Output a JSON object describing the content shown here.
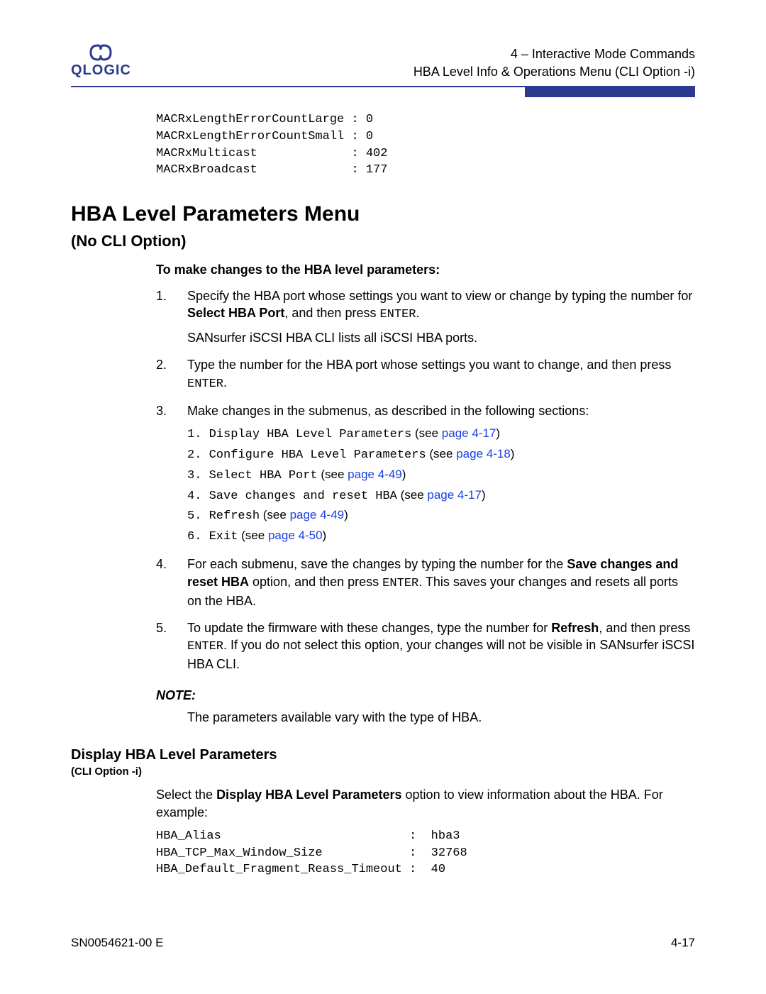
{
  "header": {
    "logo_text": "QLOGIC",
    "line1": "4 – Interactive Mode Commands",
    "line2": "HBA Level Info & Operations Menu (CLI Option -i)"
  },
  "mac_block": "MACRxLengthErrorCountLarge : 0\nMACRxLengthErrorCountSmall : 0\nMACRxMulticast             : 402\nMACRxBroadcast             : 177",
  "section": {
    "title": "HBA Level Parameters Menu",
    "subtitle": "(No CLI Option)",
    "intro": "To make changes to the HBA level parameters:"
  },
  "steps": {
    "s1_a": "Specify the HBA port whose settings you want to view or change by typing the number for ",
    "s1_bold": "Select HBA Port",
    "s1_b": ", and then press ",
    "s1_key": "ENTER",
    "s1_c": ".",
    "s1_p2": "SANsurfer iSCSI HBA CLI lists all iSCSI HBA ports.",
    "s2_a": "Type the number for the HBA port whose settings you want to change, and then press ",
    "s2_key": "ENTER",
    "s2_b": ".",
    "s3": "Make changes in the submenus, as described in the following sections:",
    "sub": [
      {
        "n": "1.",
        "cmd": "Display HBA Level Parameters",
        "see": " (see ",
        "page": "page 4-17",
        "end": ")"
      },
      {
        "n": "2.",
        "cmd": "Configure HBA Level Parameters",
        "see": " (see ",
        "page": "page 4-18",
        "end": ")"
      },
      {
        "n": "3.",
        "cmd": "Select HBA Port",
        "see": " (see ",
        "page": "page 4-49",
        "end": ")"
      },
      {
        "n": "4.",
        "cmd": "Save changes and reset HBA",
        "see": " (see ",
        "page": "page 4-17",
        "end": ")"
      },
      {
        "n": "5.",
        "cmd": "Refresh",
        "see": " (see ",
        "page": "page 4-49",
        "end": ")"
      },
      {
        "n": "6.",
        "cmd": "Exit",
        "see": " (see ",
        "page": "page 4-50",
        "end": ")"
      }
    ],
    "s4_a": "For each submenu, save the changes by typing the number for the ",
    "s4_bold": "Save changes and reset HBA",
    "s4_b": " option, and then press ",
    "s4_key": "ENTER",
    "s4_c": ". This saves your changes and resets all ports on the HBA.",
    "s5_a": "To update the firmware with these changes, type the number for ",
    "s5_bold": "Refresh",
    "s5_b": ", and then press ",
    "s5_key": "ENTER",
    "s5_c": ". If you do not select this option, your changes will not be visible in SANsurfer iSCSI HBA CLI."
  },
  "note": {
    "label": "NOTE:",
    "text": "The parameters available vary with the type of HBA."
  },
  "subsection": {
    "title": "Display HBA Level Parameters",
    "cli": "(CLI Option -i)",
    "para_a": "Select the ",
    "para_bold": "Display HBA Level Parameters",
    "para_b": " option to view information about the HBA. For example:",
    "example": "HBA_Alias                          :  hba3\nHBA_TCP_Max_Window_Size            :  32768\nHBA_Default_Fragment_Reass_Timeout :  40"
  },
  "footer": {
    "left": "SN0054621-00 E",
    "right": "4-17"
  },
  "chart_data": {
    "type": "table",
    "title": "MAC Counters",
    "rows": [
      {
        "name": "MACRxLengthErrorCountLarge",
        "value": 0
      },
      {
        "name": "MACRxLengthErrorCountSmall",
        "value": 0
      },
      {
        "name": "MACRxMulticast",
        "value": 402
      },
      {
        "name": "MACRxBroadcast",
        "value": 177
      }
    ],
    "hba_example": [
      {
        "name": "HBA_Alias",
        "value": "hba3"
      },
      {
        "name": "HBA_TCP_Max_Window_Size",
        "value": 32768
      },
      {
        "name": "HBA_Default_Fragment_Reass_Timeout",
        "value": 40
      }
    ]
  }
}
